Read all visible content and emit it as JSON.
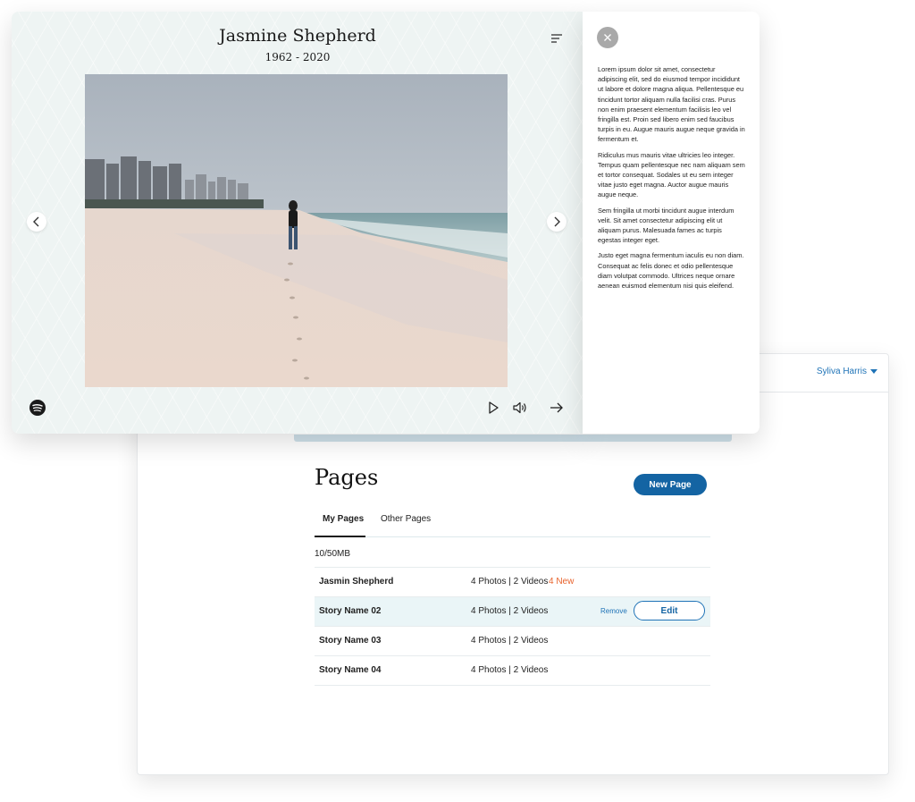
{
  "dashboard": {
    "user_name": "Syliva Harris",
    "title": "Pages",
    "new_page_label": "New Page",
    "tabs": [
      {
        "label": "My Pages",
        "active": true
      },
      {
        "label": "Other Pages",
        "active": false
      }
    ],
    "storage": "10/50MB",
    "rows": [
      {
        "name": "Jasmin Shepherd",
        "meta": "4 Photos | 2 Videos",
        "badge": "4 New"
      },
      {
        "name": "Story Name 02",
        "meta": "4 Photos | 2 Videos",
        "remove_label": "Remove",
        "edit_label": "Edit"
      },
      {
        "name": "Story Name 03",
        "meta": "4 Photos | 2 Videos"
      },
      {
        "name": "Story Name 04",
        "meta": "4 Photos | 2 Videos"
      }
    ],
    "colors": {
      "accent": "#1464a3",
      "badge": "#e8632d"
    }
  },
  "memorial": {
    "name": "Jasmine Shepherd",
    "dates": "1962 - 2020",
    "photo": "beach-walk-photo",
    "icons": {
      "menu": "menu-icon",
      "prev": "chevron-left-icon",
      "next": "chevron-right-icon",
      "music": "spotify-icon",
      "play": "play-icon",
      "volume": "volume-icon",
      "forward": "arrow-right-icon",
      "close": "close-icon"
    }
  },
  "info_panel": {
    "paragraphs": [
      "Lorem ipsum dolor sit amet, consectetur adipiscing elit, sed do eiusmod tempor incididunt ut labore et dolore magna aliqua. Pellentesque eu tincidunt tortor aliquam nulla facilisi cras. Purus non enim praesent elementum facilisis leo vel fringilla est. Proin sed libero enim sed faucibus turpis in eu. Augue mauris augue neque gravida in fermentum et.",
      "Ridiculus mus mauris vitae ultricies leo integer. Tempus quam pellentesque nec nam aliquam sem et tortor consequat. Sodales ut eu sem integer vitae justo eget magna. Auctor augue mauris augue neque.",
      "Sem fringilla ut morbi tincidunt augue interdum velit. Sit amet consectetur adipiscing elit ut aliquam purus. Malesuada fames ac turpis egestas integer eget.",
      "Justo eget magna fermentum iaculis eu non diam. Consequat ac felis donec et odio pellentesque diam volutpat commodo. Ultrices neque ornare aenean euismod elementum nisi quis eleifend."
    ]
  }
}
